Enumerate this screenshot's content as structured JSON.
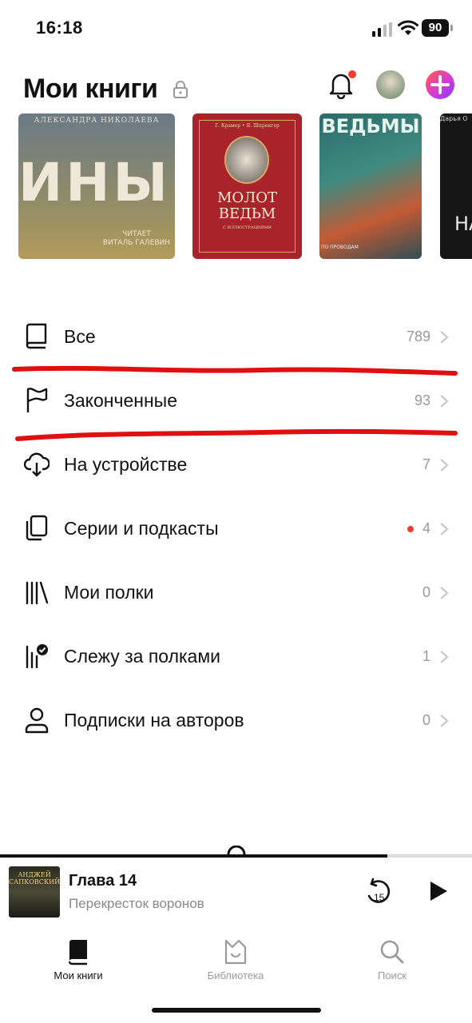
{
  "status_bar": {
    "time": "16:18",
    "battery": "90",
    "icons": [
      "cellular-signal-icon",
      "wifi-icon",
      "battery-icon"
    ]
  },
  "header": {
    "title": "Мои книги",
    "icons": [
      "lock-icon",
      "bell-icon",
      "avatar",
      "plus-badge-icon"
    ],
    "notification_dot_color": "#ef3b2d"
  },
  "covers": [
    {
      "author": "АЛЕКСАНДРА НИКОЛАЕВА",
      "title": "ИНЫЕ",
      "reader": "ЧИТАЕТ\nВИТАЛЬ ГАЛЕВИН"
    },
    {
      "authors": "Г. Крамер • Я. Шпренгер",
      "title": "МОЛОТ\nВЕДЬМ",
      "subtitle": "С ИЛЛЮСТРАЦИЯМИ"
    },
    {
      "title": "ВЕДЬМЫ",
      "footer": "ПО ПРОВОДАМ"
    },
    {
      "top_text": "Дарья О",
      "title": "НА"
    }
  ],
  "menu": [
    {
      "label": "Все",
      "count": "789",
      "icon": "book-icon",
      "has_dot": false
    },
    {
      "label": "Законченные",
      "count": "93",
      "icon": "flag-icon",
      "has_dot": false
    },
    {
      "label": "На устройстве",
      "count": "7",
      "icon": "cloud-download-icon",
      "has_dot": false
    },
    {
      "label": "Серии и подкасты",
      "count": "4",
      "icon": "copy-series-icon",
      "has_dot": true
    },
    {
      "label": "Мои полки",
      "count": "0",
      "icon": "shelves-icon",
      "has_dot": false
    },
    {
      "label": "Слежу за полками",
      "count": "1",
      "icon": "shelves-check-icon",
      "has_dot": false
    },
    {
      "label": "Подписки на авторов",
      "count": "0",
      "icon": "person-icon",
      "has_dot": false
    }
  ],
  "player": {
    "title": "Глава 14",
    "subtitle": "Перекресток воронов",
    "cover_text": "АНДЖЕЙ\nСАПКОВСКИЙ",
    "rewind_seconds": "15",
    "progress": 0.82
  },
  "tabs": [
    {
      "label": "Мои книги",
      "icon": "book-icon",
      "active": true
    },
    {
      "label": "Библиотека",
      "icon": "library-icon",
      "active": false
    },
    {
      "label": "Поиск",
      "icon": "search-icon",
      "active": false
    }
  ],
  "colors": {
    "accent_red": "#ef3b2d",
    "annotation_red": "#e01010",
    "text_primary": "#111111",
    "text_secondary": "#999999",
    "tab_inactive": "#9a9a9a"
  }
}
